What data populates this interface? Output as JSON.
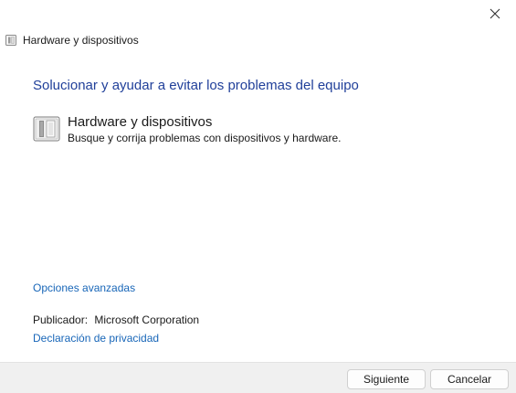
{
  "window": {
    "title": "Hardware y dispositivos",
    "title_icon": "hardware-devices-icon",
    "close_icon": "close-icon"
  },
  "main": {
    "heading": "Solucionar y ayudar a evitar los problemas del equipo",
    "item": {
      "icon": "hardware-devices-icon",
      "title": "Hardware y dispositivos",
      "description": "Busque y corrija problemas con dispositivos y hardware."
    },
    "advanced_link": "Opciones avanzadas",
    "publisher_label": "Publicador:",
    "publisher_value": "Microsoft Corporation",
    "privacy_link": "Declaración de privacidad"
  },
  "footer": {
    "next_label": "Siguiente",
    "cancel_label": "Cancelar"
  },
  "colors": {
    "heading": "#21409a",
    "link": "#1866b8",
    "footer_bg": "#f0f0f0"
  }
}
